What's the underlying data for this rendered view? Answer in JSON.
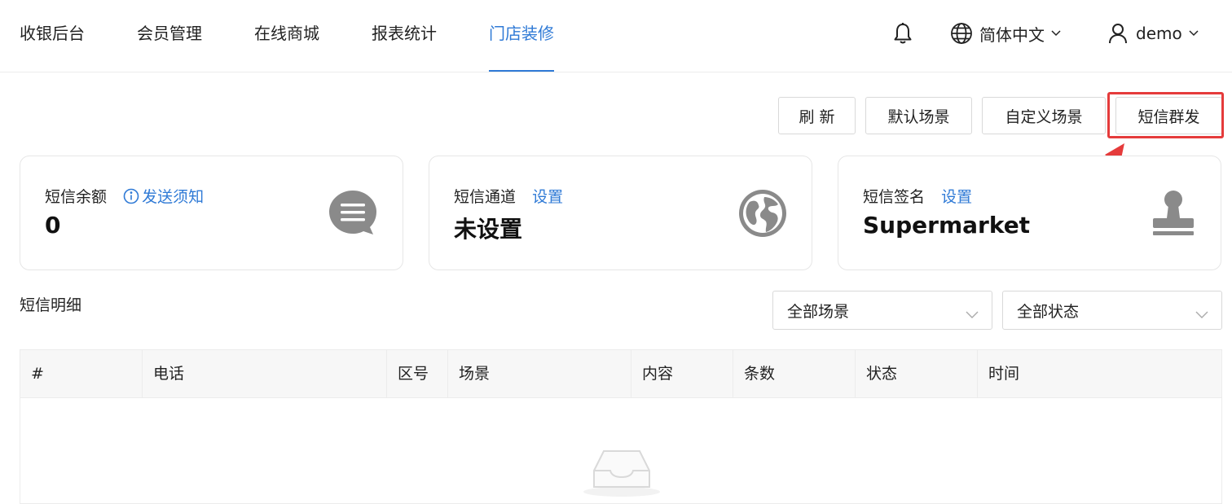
{
  "nav": {
    "items": [
      {
        "label": "收银后台"
      },
      {
        "label": "会员管理"
      },
      {
        "label": "在线商城"
      },
      {
        "label": "报表统计"
      },
      {
        "label": "门店装修",
        "active": true
      }
    ],
    "language": "简体中文",
    "user": "demo",
    "icons": {
      "notification": "bell-icon",
      "language": "globe-icon",
      "user": "user-icon"
    }
  },
  "toolbar": {
    "refresh": "刷 新",
    "default_scene": "默认场景",
    "custom_scene": "自定义场景",
    "sms_broadcast": "短信群发"
  },
  "cards": [
    {
      "label": "短信余额",
      "link": "发送须知",
      "value": "0",
      "icon": "message-bubble-icon"
    },
    {
      "label": "短信通道",
      "link": "设置",
      "value": "未设置",
      "icon": "globe-icon"
    },
    {
      "label": "短信签名",
      "link": "设置",
      "value": "Supermarket",
      "icon": "stamp-icon"
    }
  ],
  "section": {
    "title": "短信明细",
    "scene_filter": "全部场景",
    "status_filter": "全部状态"
  },
  "table": {
    "columns": [
      "#",
      "电话",
      "区号",
      "场景",
      "内容",
      "条数",
      "状态",
      "时间"
    ],
    "rows": []
  },
  "colors": {
    "accent": "#2f7ad6",
    "highlight": "#e53b3b",
    "icon_gray": "#8a8a8a"
  }
}
